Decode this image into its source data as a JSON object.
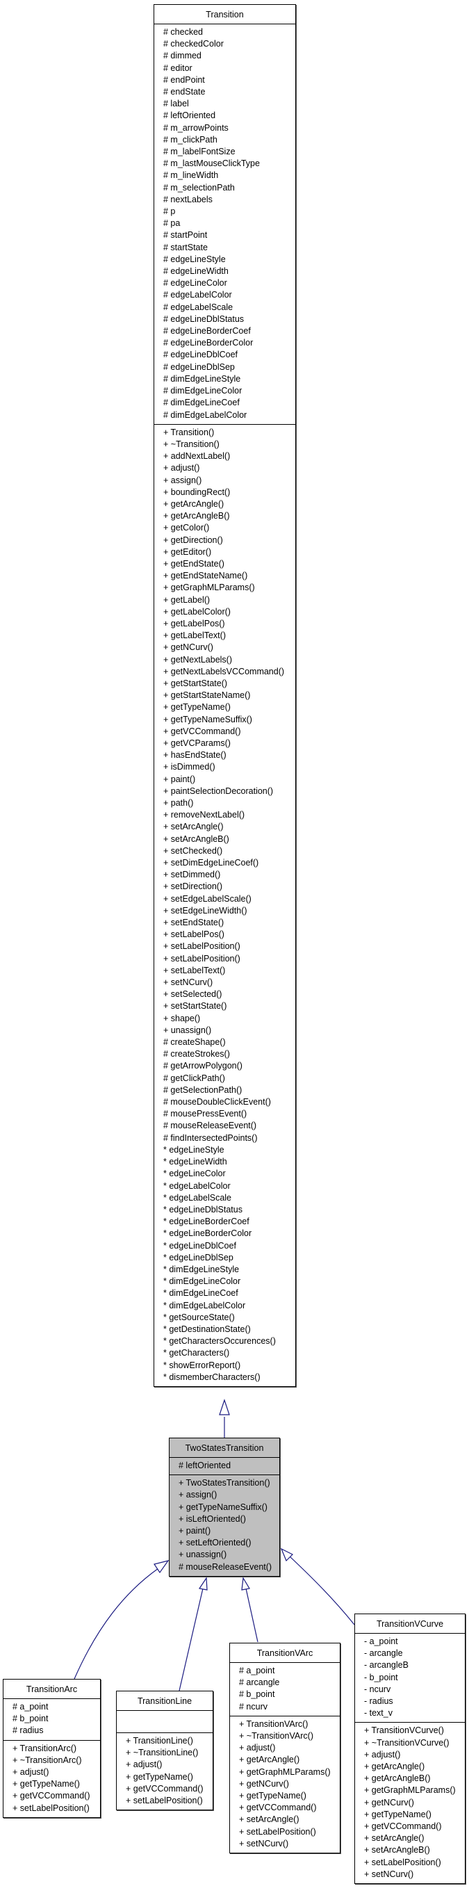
{
  "diagram": {
    "type": "class-inheritance",
    "edge_color": "#1a1a80",
    "highlight_color": "#bfbfbf",
    "classes": {
      "transition": {
        "name": "Transition",
        "attributes": [
          "# checked",
          "# checkedColor",
          "# dimmed",
          "# editor",
          "# endPoint",
          "# endState",
          "# label",
          "# leftOriented",
          "# m_arrowPoints",
          "# m_clickPath",
          "# m_labelFontSize",
          "# m_lastMouseClickType",
          "# m_lineWidth",
          "# m_selectionPath",
          "# nextLabels",
          "# p",
          "# pa",
          "# startPoint",
          "# startState",
          "# edgeLineStyle",
          "# edgeLineWidth",
          "# edgeLineColor",
          "# edgeLabelColor",
          "# edgeLabelScale",
          "# edgeLineDblStatus",
          "# edgeLineBorderCoef",
          "# edgeLineBorderColor",
          "# edgeLineDblCoef",
          "# edgeLineDblSep",
          "# dimEdgeLineStyle",
          "# dimEdgeLineColor",
          "# dimEdgeLineCoef",
          "# dimEdgeLabelColor"
        ],
        "methods": [
          "+ Transition()",
          "+ ~Transition()",
          "+ addNextLabel()",
          "+ adjust()",
          "+ assign()",
          "+ boundingRect()",
          "+ getArcAngle()",
          "+ getArcAngleB()",
          "+ getColor()",
          "+ getDirection()",
          "+ getEditor()",
          "+ getEndState()",
          "+ getEndStateName()",
          "+ getGraphMLParams()",
          "+ getLabel()",
          "+ getLabelColor()",
          "+ getLabelPos()",
          "+ getLabelText()",
          "+ getNCurv()",
          "+ getNextLabels()",
          "+ getNextLabelsVCCommand()",
          "+ getStartState()",
          "+ getStartStateName()",
          "+ getTypeName()",
          "+ getTypeNameSuffix()",
          "+ getVCCommand()",
          "+ getVCParams()",
          "+ hasEndState()",
          "+ isDimmed()",
          "+ paint()",
          "+ paintSelectionDecoration()",
          "+ path()",
          "+ removeNextLabel()",
          "+ setArcAngle()",
          "+ setArcAngleB()",
          "+ setChecked()",
          "+ setDimEdgeLineCoef()",
          "+ setDimmed()",
          "+ setDirection()",
          "+ setEdgeLabelScale()",
          "+ setEdgeLineWidth()",
          "+ setEndState()",
          "+ setLabelPos()",
          "+ setLabelPosition()",
          "+ setLabelPosition()",
          "+ setLabelText()",
          "+ setNCurv()",
          "+ setSelected()",
          "+ setStartState()",
          "+ shape()",
          "+ unassign()",
          "# createShape()",
          "# createStrokes()",
          "# getArrowPolygon()",
          "# getClickPath()",
          "# getSelectionPath()",
          "# mouseDoubleClickEvent()",
          "# mousePressEvent()",
          "# mouseReleaseEvent()",
          "# findIntersectedPoints()",
          "* edgeLineStyle",
          "* edgeLineWidth",
          "* edgeLineColor",
          "* edgeLabelColor",
          "* edgeLabelScale",
          "* edgeLineDblStatus",
          "* edgeLineBorderCoef",
          "* edgeLineBorderColor",
          "* edgeLineDblCoef",
          "* edgeLineDblSep",
          "* dimEdgeLineStyle",
          "* dimEdgeLineColor",
          "* dimEdgeLineCoef",
          "* dimEdgeLabelColor",
          "* getSourceState()",
          "* getDestinationState()",
          "* getCharactersOccurences()",
          "* getCharacters()",
          "* showErrorReport()",
          "* dismemberCharacters()"
        ]
      },
      "two_states_transition": {
        "name": "TwoStatesTransition",
        "highlighted": true,
        "attributes": [
          "# leftOriented"
        ],
        "methods": [
          "+ TwoStatesTransition()",
          "+ assign()",
          "+ getTypeNameSuffix()",
          "+ isLeftOriented()",
          "+ paint()",
          "+ setLeftOriented()",
          "+ unassign()",
          "# mouseReleaseEvent()"
        ]
      },
      "transition_arc": {
        "name": "TransitionArc",
        "attributes": [
          "# a_point",
          "# b_point",
          "# radius"
        ],
        "methods": [
          "+ TransitionArc()",
          "+ ~TransitionArc()",
          "+ adjust()",
          "+ getTypeName()",
          "+ getVCCommand()",
          "+ setLabelPosition()"
        ]
      },
      "transition_line": {
        "name": "TransitionLine",
        "attributes": [],
        "methods": [
          "+ TransitionLine()",
          "+ ~TransitionLine()",
          "+ adjust()",
          "+ getTypeName()",
          "+ getVCCommand()",
          "+ setLabelPosition()"
        ]
      },
      "transition_varc": {
        "name": "TransitionVArc",
        "attributes": [
          "# a_point",
          "# arcangle",
          "# b_point",
          "# ncurv"
        ],
        "methods": [
          "+ TransitionVArc()",
          "+ ~TransitionVArc()",
          "+ adjust()",
          "+ getArcAngle()",
          "+ getGraphMLParams()",
          "+ getNCurv()",
          "+ getTypeName()",
          "+ getVCCommand()",
          "+ setArcAngle()",
          "+ setLabelPosition()",
          "+ setNCurv()"
        ]
      },
      "transition_vcurve": {
        "name": "TransitionVCurve",
        "attributes": [
          "- a_point",
          "- arcangle",
          "- arcangleB",
          "- b_point",
          "- ncurv",
          "- radius",
          "- text_v"
        ],
        "methods": [
          "+ TransitionVCurve()",
          "+ ~TransitionVCurve()",
          "+ adjust()",
          "+ getArcAngle()",
          "+ getArcAngleB()",
          "+ getGraphMLParams()",
          "+ getNCurv()",
          "+ getTypeName()",
          "+ getVCCommand()",
          "+ setArcAngle()",
          "+ setArcAngleB()",
          "+ setLabelPosition()",
          "+ setNCurv()"
        ]
      }
    },
    "edges": [
      {
        "from": "two_states_transition",
        "to": "transition",
        "kind": "inheritance"
      },
      {
        "from": "transition_arc",
        "to": "two_states_transition",
        "kind": "inheritance"
      },
      {
        "from": "transition_line",
        "to": "two_states_transition",
        "kind": "inheritance"
      },
      {
        "from": "transition_varc",
        "to": "two_states_transition",
        "kind": "inheritance"
      },
      {
        "from": "transition_vcurve",
        "to": "two_states_transition",
        "kind": "inheritance"
      }
    ]
  }
}
